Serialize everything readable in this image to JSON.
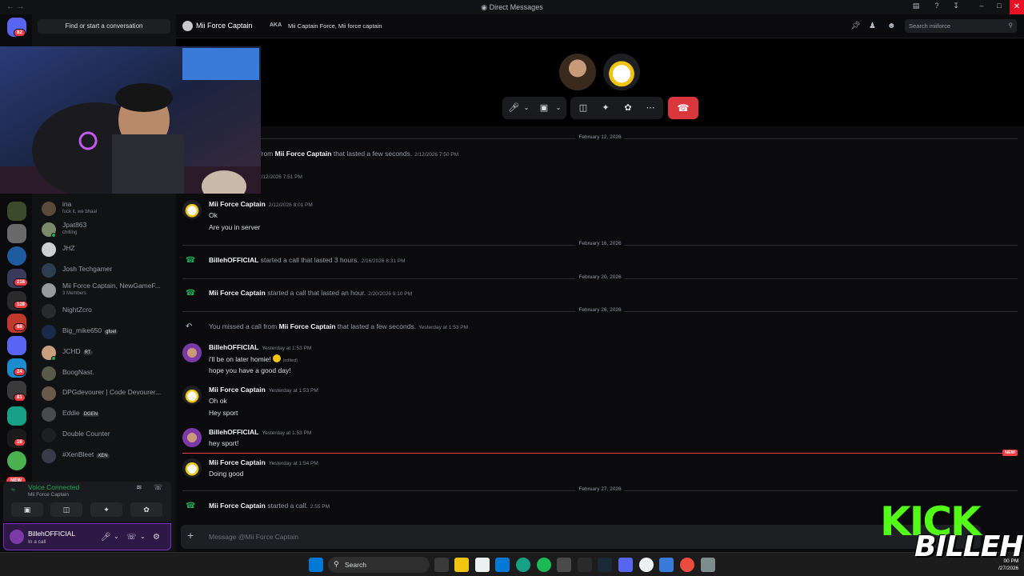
{
  "window": {
    "title": "Direct Messages"
  },
  "server_badges": [
    "82",
    "216",
    "128",
    "68",
    "24",
    "81",
    "16"
  ],
  "new_badge": "NEW",
  "dm_list": {
    "find_placeholder": "Find or start a conversation",
    "items": [
      {
        "name": "ina",
        "sub": "fuck it, we bhaal"
      },
      {
        "name": "Jpat863",
        "sub": "chilling"
      },
      {
        "name": "JHZ"
      },
      {
        "name": "Josh Techgamer"
      },
      {
        "name": "Mii Force Captain, NewGameF...",
        "sub": "3 Members"
      },
      {
        "name": "NightZcro"
      },
      {
        "name": "Big_mike650",
        "tag": "gfuel"
      },
      {
        "name": "JCHD",
        "tag": "RT"
      },
      {
        "name": "BoogNast."
      },
      {
        "name": "DPGdevourer | Code Devourer..."
      },
      {
        "name": "Eddie",
        "tag": "DGEN"
      },
      {
        "name": "Double Counter"
      },
      {
        "name": "#XenBleet",
        "tag": "XEN"
      }
    ]
  },
  "voice": {
    "status": "Voice Connected",
    "channel": "Mii Force Captain"
  },
  "user": {
    "name": "BillehOFFICIAL",
    "status": "In a call"
  },
  "header": {
    "title": "Mii Force Captain",
    "aka_label": "AKA",
    "aka_value": "Mii Captain Force, Mii force captain",
    "search_placeholder": "Search miiforce"
  },
  "chat": {
    "partial_1": {
      "text_pre": "l from",
      "name": "Mii Force Captain",
      "text_post": "that lasted a few seconds.",
      "ts": "2/12/2026 7:50 PM"
    },
    "partial_2": {
      "ts": "2/12/2026 7:51 PM"
    },
    "dates": [
      "February 12, 2026",
      "February 16, 2026",
      "February 20, 2026",
      "February 26, 2026",
      "February 27, 2026"
    ],
    "msg1": {
      "author": "Mii Force Captain",
      "ts": "2/12/2026 8:01 PM",
      "lines": [
        "Ok",
        "Are you in server"
      ]
    },
    "sys1": {
      "name": "BillehOFFICIAL",
      "text": "started a call that lasted 3 hours.",
      "ts": "2/16/2026 8:31 PM"
    },
    "sys2": {
      "name": "Mii Force Captain",
      "text": "started a call that lasted an hour.",
      "ts": "2/20/2026 9:10 PM"
    },
    "sys3": {
      "pre": "You missed a call from",
      "name": "Mii Force Captain",
      "text": "that lasted a few seconds.",
      "ts": "Yesterday at 1:53 PM"
    },
    "msg2": {
      "author": "BillehOFFICIAL",
      "ts": "Yesterday at 1:53 PM",
      "line1": "i'll be on later homie!",
      "edited": "(edited)",
      "line2": "hope you have a good day!"
    },
    "msg3": {
      "author": "Mii Force Captain",
      "ts": "Yesterday at 1:53 PM",
      "lines": [
        "Oh ok",
        "Hey sport"
      ]
    },
    "msg4": {
      "author": "BillehOFFICIAL",
      "ts": "Yesterday at 1:53 PM",
      "lines": [
        "hey sport!"
      ]
    },
    "new_label": "NEW",
    "msg5": {
      "author": "Mii Force Captain",
      "ts": "Yesterday at 1:54 PM",
      "lines": [
        "Doing good"
      ]
    },
    "sys4": {
      "name": "Mii Force Captain",
      "text": "started a call.",
      "ts": "2:55 PM"
    }
  },
  "composer": {
    "placeholder": "Message @Mii Force Captain"
  },
  "taskbar": {
    "search": "Search",
    "time": "00 PM",
    "date": "/27/2026"
  },
  "overlay": {
    "line1": "KICK",
    "line2": "BILLEH"
  },
  "colors": {
    "accent_green": "#23a55a",
    "danger": "#da373c",
    "kick_green": "#53fc18"
  }
}
